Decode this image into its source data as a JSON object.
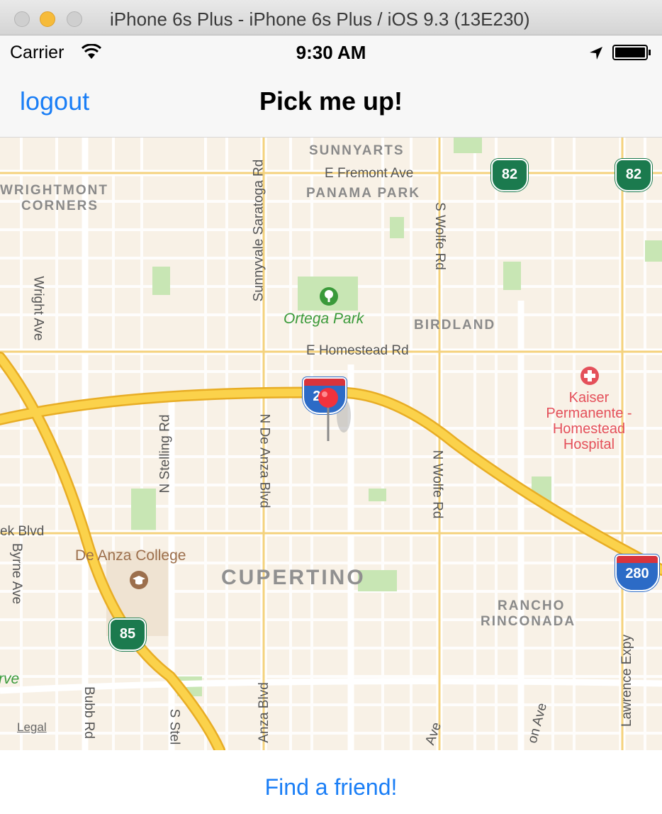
{
  "window": {
    "title": "iPhone 6s Plus - iPhone 6s Plus / iOS 9.3 (13E230)"
  },
  "status_bar": {
    "carrier": "Carrier",
    "time": "9:30 AM"
  },
  "nav": {
    "left_button": "logout",
    "title": "Pick me up!"
  },
  "map": {
    "districts": [
      "SUNNYARTS",
      "PANAMA PARK",
      "WRIGHTMONT",
      "CORNERS",
      "BIRDLAND",
      "RANCHO",
      "RINCONADA"
    ],
    "city": "CUPERTINO",
    "streets": [
      "E Fremont Ave",
      "E Homestead Rd",
      "Sunnyvale Saratoga Rd",
      "S Wolfe Rd",
      "Wright Ave",
      "N Stelling Rd",
      "N De Anza Blvd",
      "N Wolfe Rd",
      "ek Blvd",
      "Byrne Ave",
      "Bubb Rd",
      "S Stel",
      "Anza Blvd",
      "Lawrence Expy",
      "Ave",
      "on Ave"
    ],
    "park_label": "Ortega Park",
    "partial_label": "rve",
    "hospital_lines": [
      "Kaiser",
      "Permanente -",
      "Homestead",
      "Hospital"
    ],
    "college_label": "De Anza College",
    "shields": {
      "sr82_a": "82",
      "sr82_b": "82",
      "sr85": "85",
      "i280_center": "280",
      "i280_east": "280"
    },
    "legal": "Legal"
  },
  "bottom": {
    "button_label": "Find a friend!"
  },
  "colors": {
    "accent": "#1a7ef6",
    "map_bg": "#f8f1e6",
    "highway": "#f9c63a",
    "park": "#c8e6b4",
    "pin": "#f0323c"
  },
  "icons": [
    "wifi-icon",
    "location-arrow-icon",
    "battery-icon",
    "park-tree-icon",
    "hospital-cross-icon",
    "college-icon",
    "map-pin-icon"
  ]
}
